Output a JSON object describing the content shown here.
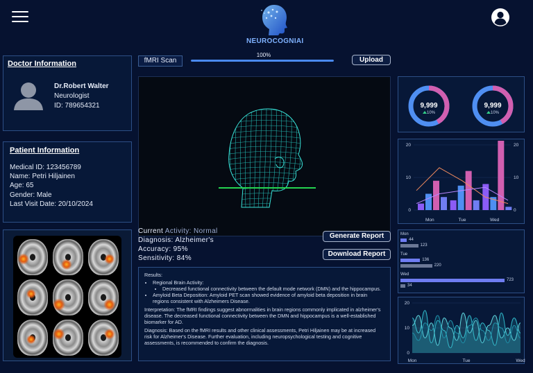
{
  "header": {
    "app_name": "NEUROCOGNIAI",
    "menu_icon": "hamburger-icon",
    "profile_icon": "user-circle-icon"
  },
  "scan": {
    "tag": "fMRI Scan",
    "progress_label": "100%",
    "progress": 1.0,
    "upload_label": "Upload"
  },
  "doctor": {
    "title": "Doctor Information",
    "name": "Dr.Robert Walter",
    "role": "Neurologist",
    "id": "ID: 789654321"
  },
  "patient": {
    "title": "Patient Information",
    "medical_id": "Medical ID: 123456789",
    "name": "Name: Petri Hiljainen",
    "age": "Age: 65",
    "gender": "Gender: Male",
    "last_visit": "Last Visit Date: 20/10/2024"
  },
  "status": {
    "activity_label": "Current",
    "activity_value": "Activity: Normal",
    "diagnosis": "Diagnosis: Alzheimer's",
    "accuracy": "Accuracy: 95%",
    "sensitivity": "Sensitivity: 84%"
  },
  "actions": {
    "generate_label": "Generate Report",
    "download_label": "Download Report"
  },
  "results": {
    "heading": "Results:",
    "activity_head": "Regional Brain Activity:",
    "activity_item": "Decreased functional connectivity between the default mode network (DMN) and the hippocampus.",
    "amyloid_item": "Amyloid Beta Deposition: Amyloid PET scan showed evidence of amyloid beta deposition in brain regions consistent with Alzheimers Disease.",
    "interpretation": "Interpretation: The fMRI findings suggest abnormalities in brain regions commonly implicated in alzheimer's disease. The decreased functional connectivity between the DMN and hippocampus is a well-established biomarker for AD.",
    "diagnosis": "Diagnosis: Based on the fMRI results and other clinical assessments, Petri Hiljainen may be at increased risk for Alzheimer's Disease. Further evaluation, including neuropsychological testing and cognitive assessments, is recommended to confirm the diagnosis."
  },
  "donuts": [
    {
      "value": "9,999",
      "delta": "10%",
      "icon": "arrow-up-icon"
    },
    {
      "value": "9,999",
      "delta": "10%",
      "icon": "arrow-up-icon"
    }
  ],
  "colors": {
    "pink": "#d15fb0",
    "purple": "#8b5cf6",
    "blue": "#4f8ff2",
    "periwinkle": "#6f7df2",
    "teal": "#3bb7c9",
    "gray_bar": "#6b7896"
  },
  "chart_data": [
    {
      "type": "bar",
      "categories": [
        "Mon",
        "Tue",
        "Wed"
      ],
      "ylim": [
        0,
        20
      ],
      "yticks": [
        "0",
        "10",
        "20"
      ],
      "yticks_right": [
        "0",
        "10",
        "20"
      ],
      "series": [
        {
          "values": [
            2,
            3,
            8
          ]
        },
        {
          "values": [
            5,
            7.5,
            4
          ]
        },
        {
          "values": [
            9,
            12,
            21.5
          ]
        },
        {
          "values": [
            4,
            3,
            1
          ]
        }
      ],
      "lines": [
        {
          "values": [
            6,
            13,
            9,
            4,
            2
          ]
        },
        {
          "values": [
            2,
            5,
            6,
            7,
            3
          ]
        }
      ]
    },
    {
      "type": "bar",
      "orientation": "horizontal",
      "categories": [
        "Mon",
        "Tue",
        "Wed"
      ],
      "series": [
        {
          "values": [
            44,
            136,
            723
          ]
        },
        {
          "values": [
            123,
            220,
            34
          ]
        }
      ]
    },
    {
      "type": "line",
      "x": [
        "Mon",
        "Tue",
        "Wed"
      ],
      "ylim": [
        0,
        20
      ],
      "yticks": [
        "0",
        "10",
        "20"
      ],
      "series": [
        {
          "values": [
            14,
            8,
            17,
            4,
            13,
            9,
            2,
            11,
            6,
            15,
            5,
            12,
            9,
            3,
            16,
            7,
            14,
            8
          ]
        },
        {
          "values": [
            11,
            15,
            6,
            12,
            3,
            14,
            10,
            5,
            16,
            8,
            13,
            4,
            11,
            15,
            6,
            10,
            5,
            12
          ]
        },
        {
          "values": [
            8,
            5,
            12,
            9,
            15,
            6,
            13,
            8,
            4,
            11,
            14,
            9,
            5,
            12,
            10,
            4,
            11,
            6
          ]
        }
      ]
    }
  ]
}
